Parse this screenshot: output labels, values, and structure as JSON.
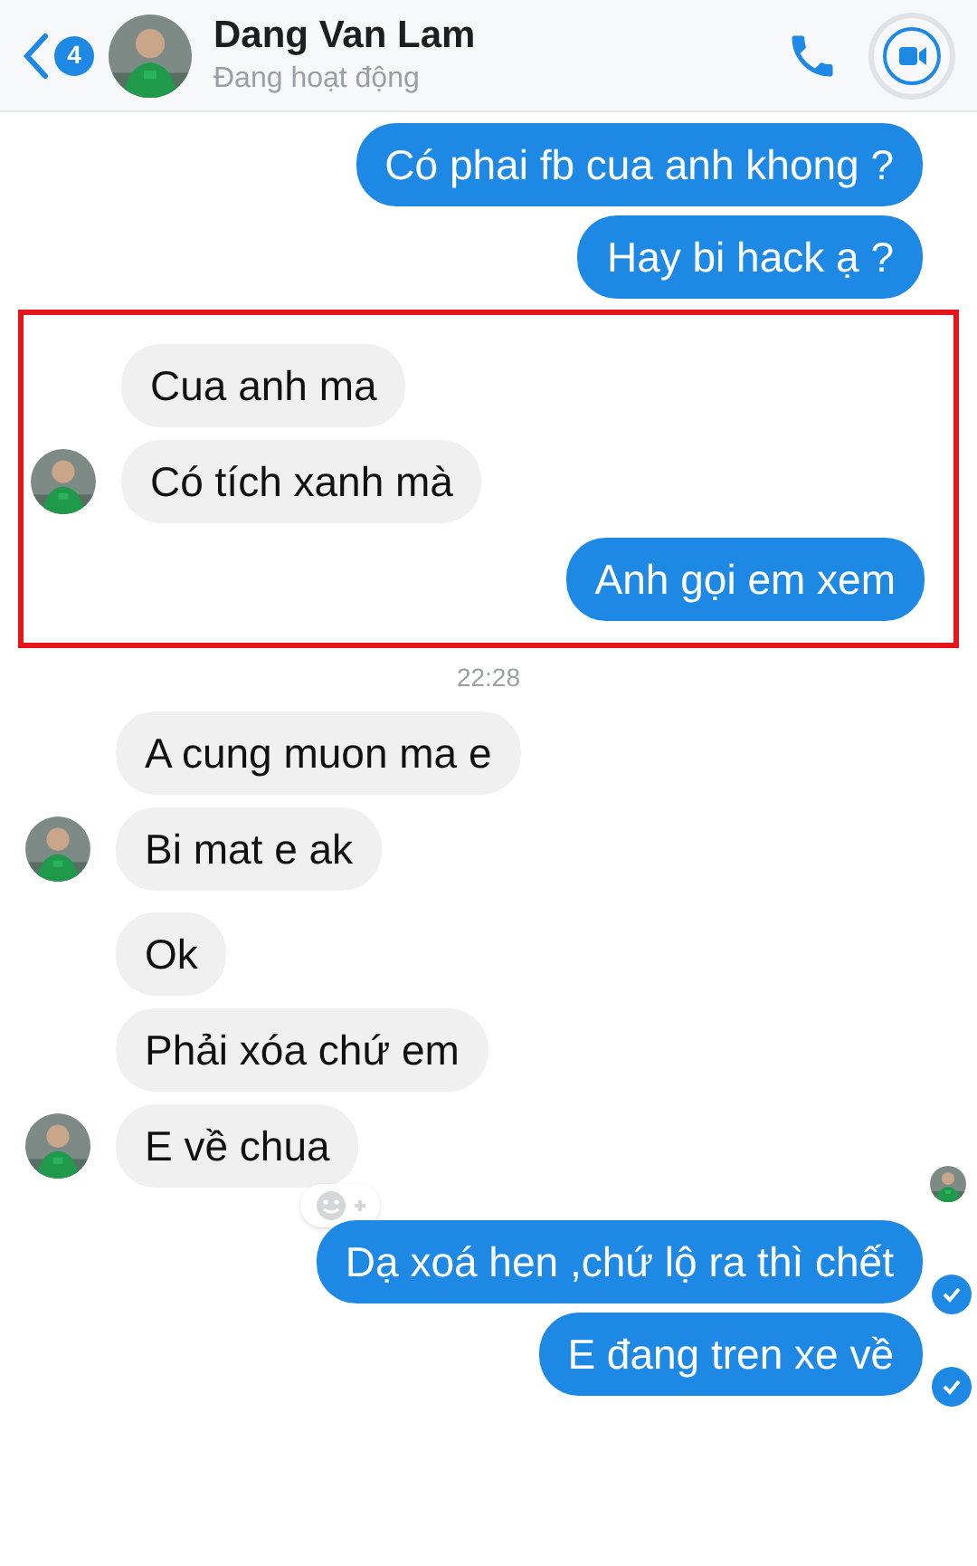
{
  "header": {
    "back_count": "4",
    "name": "Dang Van Lam",
    "status": "Đang hoạt động"
  },
  "thread": [
    {
      "kind": "outgoing",
      "highlighted": false,
      "messages": [
        {
          "text": "Có phai fb cua anh khong ?",
          "seen": false
        },
        {
          "text": "Hay bi hack ạ ?",
          "seen": false
        }
      ]
    },
    {
      "kind": "incoming",
      "highlighted": true,
      "messages": [
        {
          "text": "Cua anh ma",
          "reaction_button": false
        },
        {
          "text": "Có tích xanh mà",
          "reaction_button": false
        }
      ]
    },
    {
      "kind": "outgoing",
      "highlighted": true,
      "messages": [
        {
          "text": "Anh gọi em xem",
          "seen": false
        }
      ]
    },
    {
      "kind": "timestamp",
      "text": "22:28"
    },
    {
      "kind": "incoming",
      "highlighted": false,
      "messages": [
        {
          "text": "A cung muon ma e",
          "reaction_button": false
        },
        {
          "text": "Bi mat e ak",
          "reaction_button": false
        }
      ]
    },
    {
      "kind": "incoming",
      "highlighted": false,
      "messages": [
        {
          "text": "Ok",
          "reaction_button": false
        },
        {
          "text": "Phải xóa chứ em",
          "reaction_button": false
        },
        {
          "text": "E về chua",
          "reaction_button": true
        }
      ]
    },
    {
      "kind": "seen_avatar"
    },
    {
      "kind": "outgoing",
      "highlighted": false,
      "messages": [
        {
          "text": "Dạ xoá hen ,chứ lộ ra thì chết",
          "seen": true
        },
        {
          "text": "E đang tren xe về",
          "seen": true
        }
      ]
    }
  ]
}
